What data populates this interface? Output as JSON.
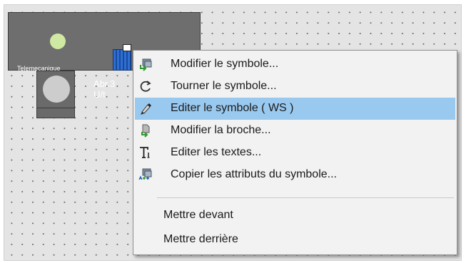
{
  "symbol": {
    "brand_label": "Telemecanique",
    "sub_label_line1": "Abr.3",
    "sub_label_line2": "U/t"
  },
  "context_menu": {
    "items": [
      {
        "label": "Modifier le symbole...",
        "icon": "modify-symbol-icon"
      },
      {
        "label": "Tourner le symbole...",
        "icon": "rotate-icon"
      },
      {
        "label": "Editer le symbole ( WS )",
        "icon": "edit-pen-icon",
        "highlighted": true
      },
      {
        "label": "Modifier la broche...",
        "icon": "modify-pin-icon"
      },
      {
        "label": "Editer les textes...",
        "icon": "text-icon"
      },
      {
        "label": "Copier les attributs du symbole...",
        "icon": "copy-attributes-icon"
      },
      {
        "label": "Mettre devant"
      },
      {
        "label": "Mettre derrière"
      }
    ]
  },
  "colors": {
    "highlight": "#99c9ef",
    "menu_background": "#f2f2f2",
    "symbol_fill": "#6e6e6e",
    "led_green": "#cfe9a3"
  }
}
